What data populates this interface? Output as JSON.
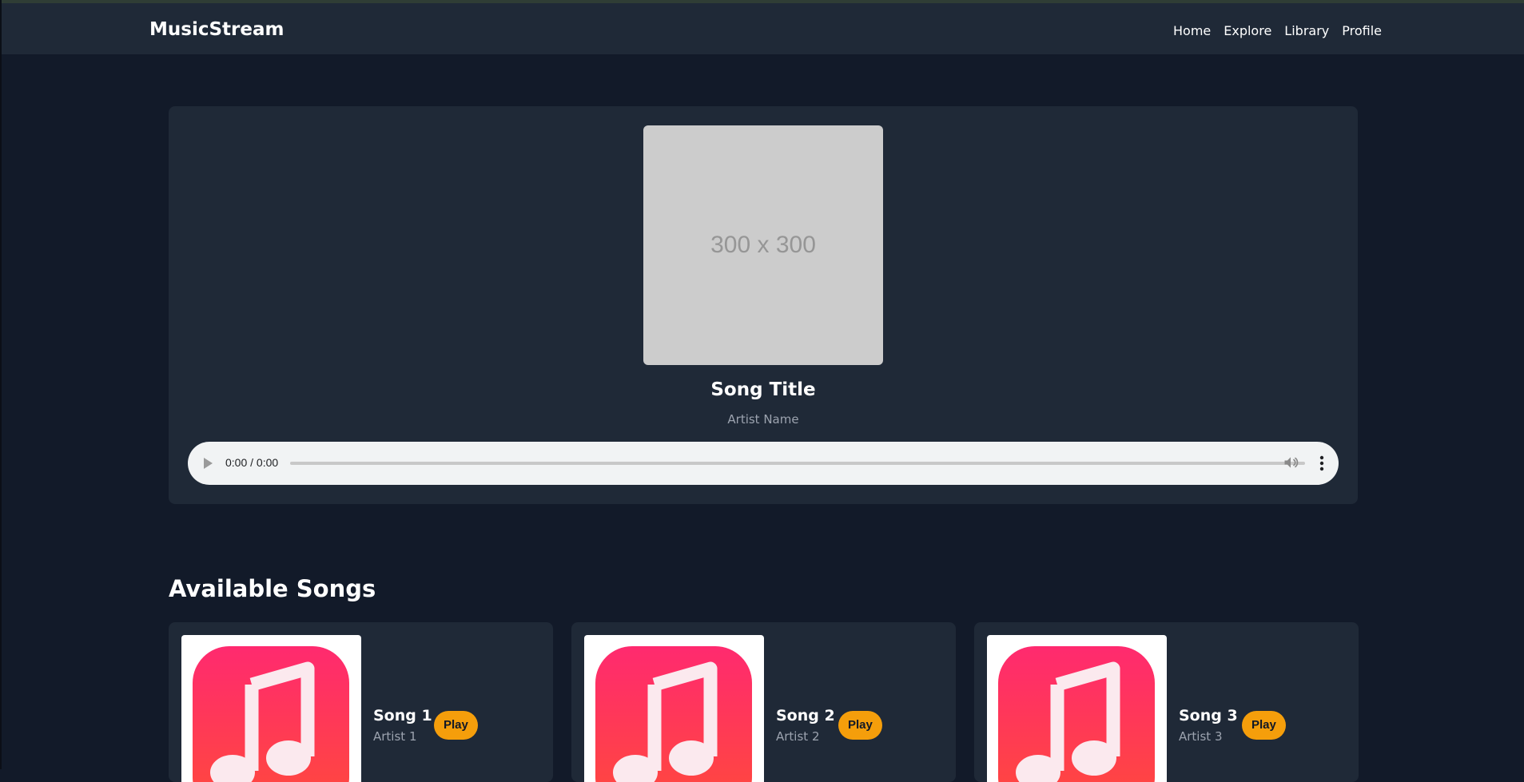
{
  "app": {
    "brand": "MusicStream"
  },
  "nav": {
    "items": [
      "Home",
      "Explore",
      "Library",
      "Profile"
    ]
  },
  "player": {
    "cover_placeholder": "300 x 300",
    "title": "Song Title",
    "artist": "Artist Name",
    "time": "0:00 / 0:00",
    "progress": 0
  },
  "songs": {
    "heading": "Available Songs",
    "items": [
      {
        "title": "Song 1",
        "artist": "Artist 1",
        "action": "Play"
      },
      {
        "title": "Song 2",
        "artist": "Artist 2",
        "action": "Play"
      },
      {
        "title": "Song 3",
        "artist": "Artist 3",
        "action": "Play"
      }
    ]
  },
  "icons": {
    "play": "play-icon",
    "volume": "volume-icon",
    "more": "more-vertical-icon",
    "music_note": "music-note-icon"
  },
  "colors": {
    "background": "#121a29",
    "surface": "#1f2937",
    "accent": "#f59e0b",
    "muted_text": "#9ca3af",
    "icon_gradient_top": "#ff2a6f",
    "icon_gradient_bottom": "#ff4a3a"
  }
}
